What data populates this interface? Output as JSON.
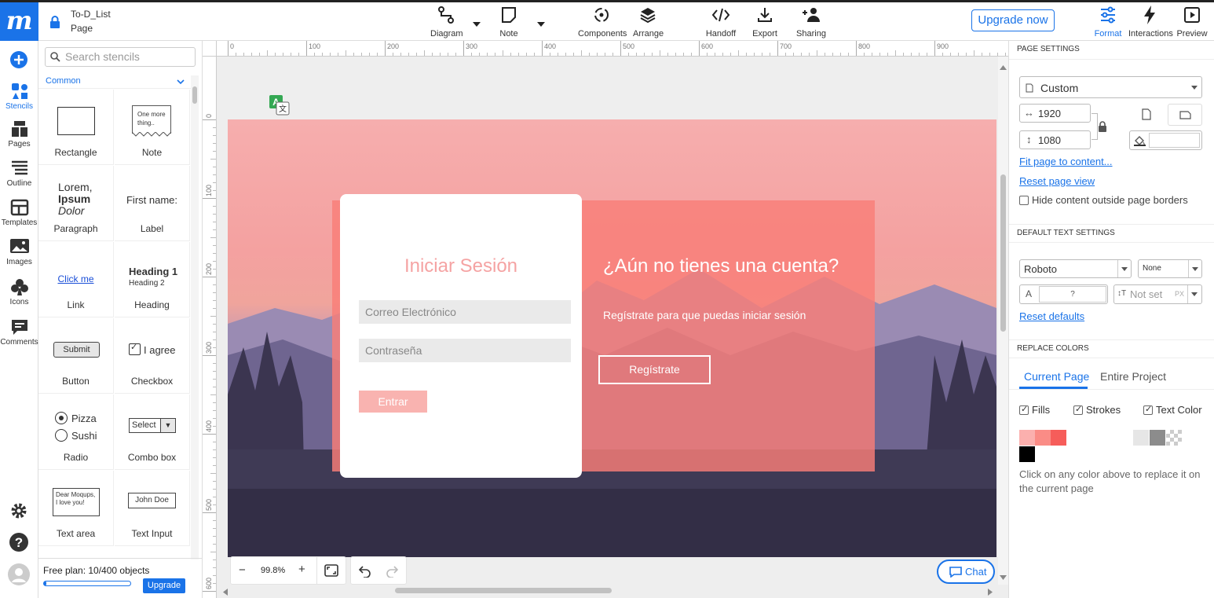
{
  "app": {
    "title": "To-D_List",
    "subtitle": "Page",
    "logo": "m"
  },
  "toolbar": {
    "diagram": "Diagram",
    "note": "Note",
    "components": "Components",
    "arrange": "Arrange",
    "handoff": "Handoff",
    "export": "Export",
    "sharing": "Sharing",
    "upgrade": "Upgrade now",
    "format": "Format",
    "interactions": "Interactions",
    "preview": "Preview"
  },
  "leftnav": {
    "stencils": "Stencils",
    "pages": "Pages",
    "outline": "Outline",
    "templates": "Templates",
    "images": "Images",
    "icons": "Icons",
    "comments": "Comments"
  },
  "stencils": {
    "search_placeholder": "Search stencils",
    "category": "Common",
    "items": [
      "Rectangle",
      "Note",
      "Paragraph",
      "Label",
      "Link",
      "Heading",
      "Button",
      "Checkbox",
      "Radio",
      "Combo box",
      "Text area",
      "Text Input"
    ],
    "previews": {
      "note_text": "One more thing..",
      "para1": "Lorem,",
      "para2": "Ipsum",
      "para3": "Dolor",
      "label_text": "First name:",
      "link_text": "Click me",
      "h1": "Heading 1",
      "h2": "Heading 2",
      "button_text": "Submit",
      "checkbox_text": "I agree",
      "radio1": "Pizza",
      "radio2": "Sushi",
      "combo_text": "Select",
      "textarea_text": "Dear Moqups, I love you!",
      "textinput_text": "John Doe"
    },
    "plan": "Free plan: 10/400 objects",
    "plan_usage": 0.025,
    "upgrade": "Upgrade"
  },
  "ruler": {
    "h": [
      "0",
      "100",
      "200",
      "300",
      "400",
      "500",
      "600",
      "700",
      "800",
      "900"
    ],
    "v": [
      "0",
      "100",
      "200",
      "300",
      "400",
      "500",
      "600"
    ]
  },
  "design": {
    "login_title": "Iniciar Sesión",
    "email_placeholder": "Correo Electrónico",
    "password_placeholder": "Contraseña",
    "login_button": "Entrar",
    "signup_title": "¿Aún no tienes una cuenta?",
    "signup_text": "Regístrate para que puedas iniciar sesión",
    "signup_button": "Regístrate"
  },
  "zoom": {
    "level": "99.8%",
    "minus": "−",
    "plus": "+"
  },
  "chat": "Chat",
  "panel": {
    "page_settings": "PAGE SETTINGS",
    "page_size": "Custom",
    "width": "1920",
    "height": "1080",
    "fit": "Fit page to content...",
    "reset_view": "Reset page view",
    "hide_content": "Hide content outside page borders",
    "default_text": "DEFAULT TEXT SETTINGS",
    "font": "Roboto",
    "style": "None",
    "size": "?",
    "line_height": "Not set",
    "px": "PX",
    "reset_defaults": "Reset defaults",
    "replace_colors": "REPLACE COLORS",
    "tab_current": "Current Page",
    "tab_entire": "Entire Project",
    "fills": "Fills",
    "strokes": "Strokes",
    "text_color": "Text Color",
    "hint": "Click on any color above to replace it on the current page",
    "swatches": [
      "#fbb0ae",
      "#fa8c86",
      "#f65d5a",
      "#ffffff",
      "#ffffff",
      "#e6e6e6",
      "#8c8c8c",
      "#000000"
    ]
  }
}
